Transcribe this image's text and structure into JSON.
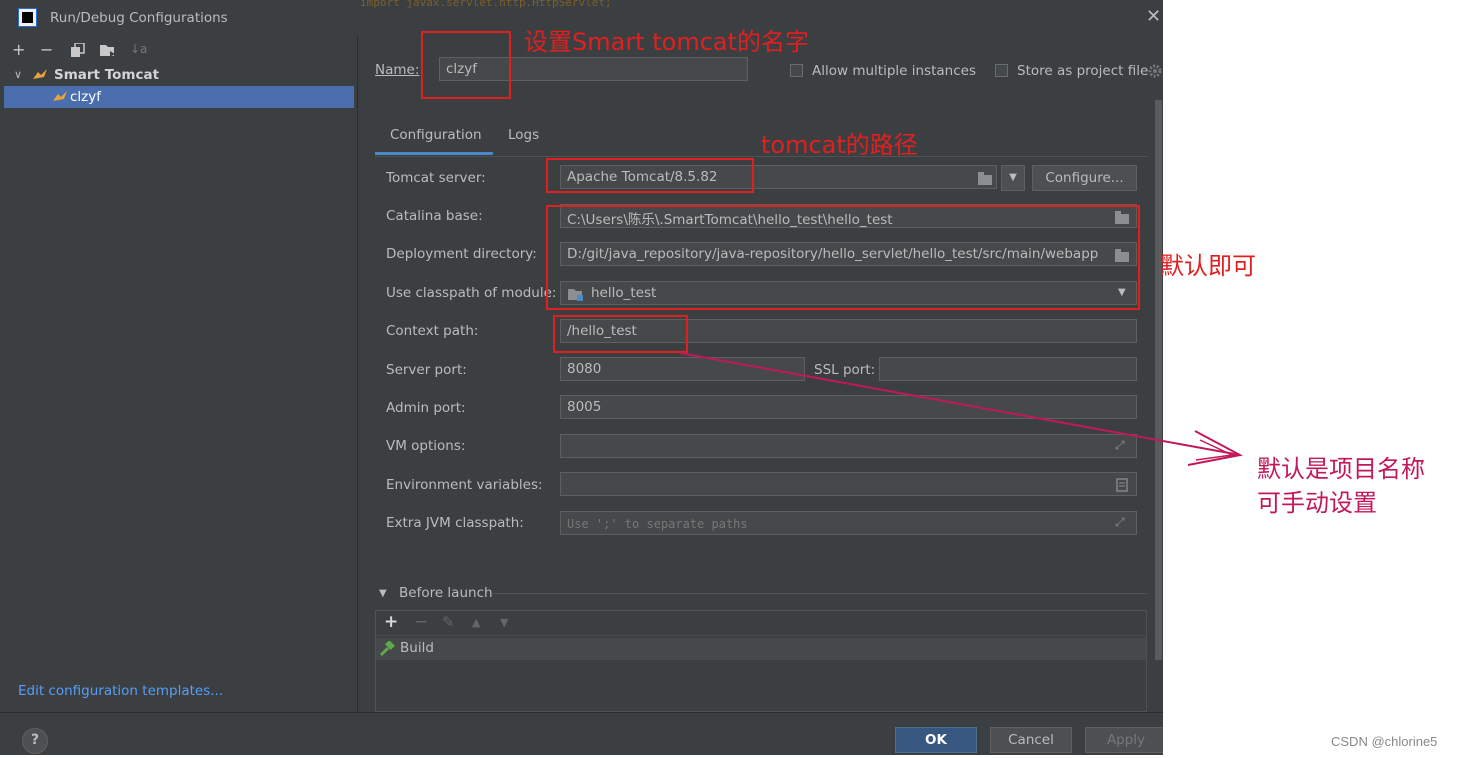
{
  "window": {
    "title": "Run/Debug Configurations",
    "close_glyph": "✕",
    "background_code": "import javax.servlet.http.HttpServlet;"
  },
  "toolbar": {
    "add": "+",
    "remove": "−",
    "copy_icon": "copy-icon",
    "folder_icon": "folder-icon",
    "sort": "↓a"
  },
  "tree": {
    "group_label": "Smart Tomcat",
    "item_label": "clzyf"
  },
  "edit_templates_link": "Edit configuration templates...",
  "name_row": {
    "label": "Name:",
    "value": "clzyf",
    "allow_multiple": "Allow multiple instances",
    "store_as_project": "Store as project file"
  },
  "tabs": [
    "Configuration",
    "Logs"
  ],
  "form": {
    "tomcat_server_label": "Tomcat server:",
    "tomcat_server_value": "Apache Tomcat/8.5.82",
    "configure_button": "Configure...",
    "catalina_base_label": "Catalina base:",
    "catalina_base_value": "C:\\Users\\陈乐\\.SmartTomcat\\hello_test\\hello_test",
    "deploy_dir_label": "Deployment directory:",
    "deploy_dir_value": "D:/git/java_repository/java-repository/hello_servlet/hello_test/src/main/webapp",
    "classpath_label": "Use classpath of module:",
    "classpath_value": "hello_test",
    "context_path_label": "Context path:",
    "context_path_value": "/hello_test",
    "server_port_label": "Server port:",
    "server_port_value": "8080",
    "ssl_port_label": "SSL port:",
    "ssl_port_value": "",
    "admin_port_label": "Admin port:",
    "admin_port_value": "8005",
    "vm_options_label": "VM options:",
    "env_vars_label": "Environment variables:",
    "extra_jvm_label": "Extra JVM classpath:",
    "extra_jvm_placeholder": "Use ';' to separate paths"
  },
  "before_launch": {
    "title": "Before launch",
    "add": "+",
    "remove": "−",
    "edit": "✎",
    "up": "▲",
    "down": "▼",
    "item": "Build"
  },
  "footer": {
    "help": "?",
    "ok": "OK",
    "cancel": "Cancel",
    "apply": "Apply"
  },
  "annotations": {
    "name_note": "设置Smart tomcat的名字",
    "path_note": "tomcat的路径",
    "default_note": "默认即可",
    "context_note_line1": "默认是项目名称",
    "context_note_line2": "可手动设置",
    "color_red": "#e02020",
    "color_magenta": "#c2185b"
  },
  "watermark": "CSDN @chlorine5"
}
